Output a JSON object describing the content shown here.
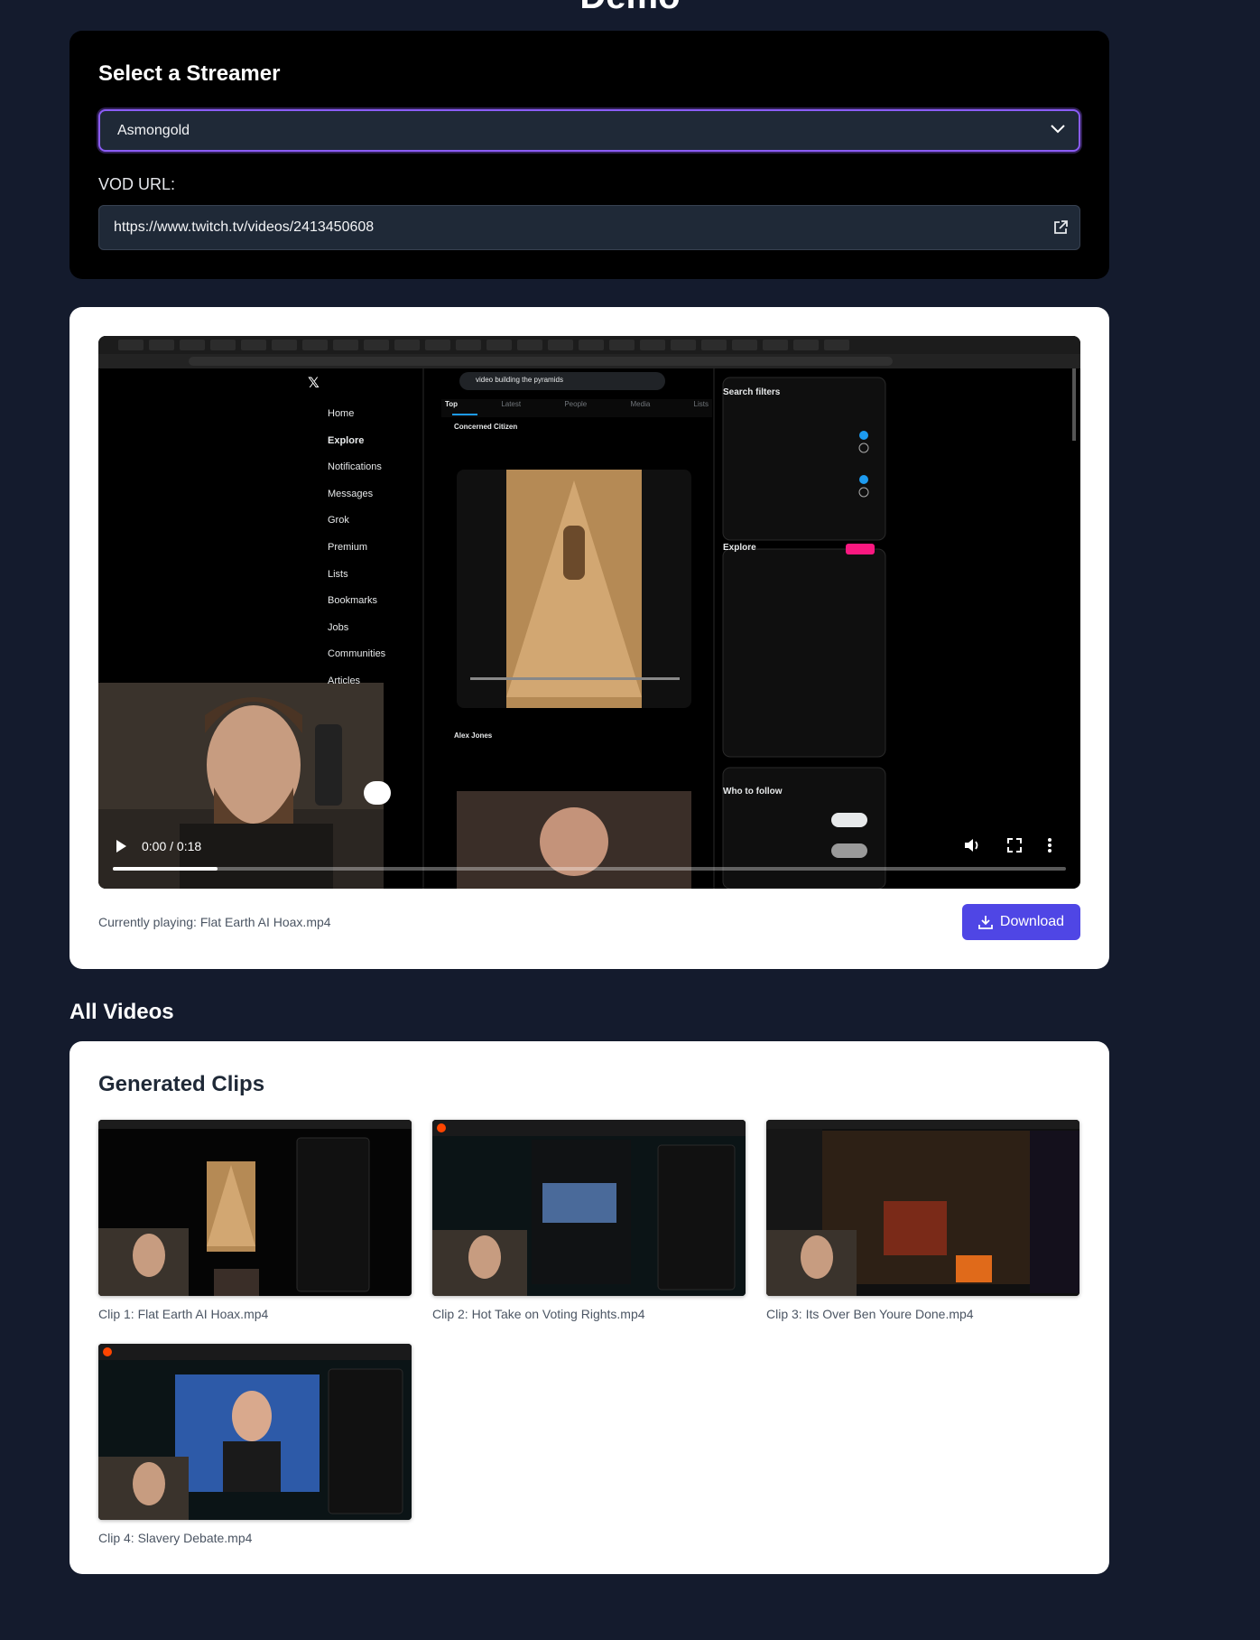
{
  "page": {
    "title": "Demo"
  },
  "streamer": {
    "heading": "Select a Streamer",
    "selected": "Asmongold",
    "vod_label": "VOD URL:",
    "vod_url": "https://www.twitch.tv/videos/2413450608"
  },
  "player": {
    "time_display": "0:00 / 0:18",
    "progress": 0.11,
    "screen": {
      "search_query": "video building the pyramids",
      "tabs": [
        "Top",
        "Latest",
        "People",
        "Media",
        "Lists"
      ],
      "nav": [
        "Home",
        "Explore",
        "Notifications",
        "Messages",
        "Grok",
        "Premium",
        "Lists",
        "Bookmarks",
        "Jobs",
        "Communities",
        "Articles"
      ],
      "filters_title": "Search filters",
      "explore_title": "Explore",
      "who_to_follow": "Who to follow",
      "post_author": "Concerned Citizen",
      "post2_author": "Alex Jones"
    },
    "now_playing": "Currently playing: Flat Earth AI Hoax.mp4",
    "download_label": "Download"
  },
  "all_videos": {
    "heading": "All Videos",
    "generated_title": "Generated Clips",
    "clips": [
      {
        "label": "Clip 1: Flat Earth AI Hoax.mp4"
      },
      {
        "label": "Clip 2: Hot Take on Voting Rights.mp4"
      },
      {
        "label": "Clip 3: Its Over Ben Youre Done.mp4"
      },
      {
        "label": "Clip 4: Slavery Debate.mp4"
      }
    ]
  },
  "colors": {
    "accent": "#8b5cf6",
    "button": "#4f46e5",
    "page_bg": "#141b2d"
  }
}
